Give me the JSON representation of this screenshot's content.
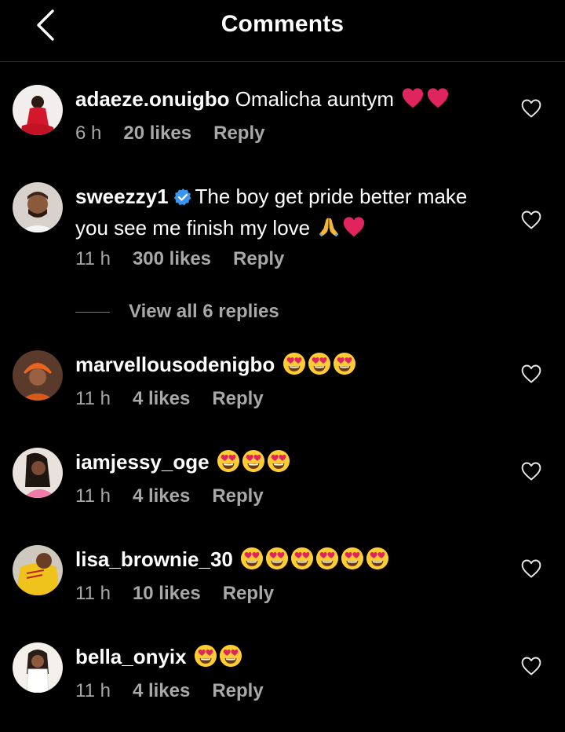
{
  "header": {
    "title": "Comments",
    "back_icon": "back-arrow-icon"
  },
  "comments": [
    {
      "username": "adaeze.onuigbo",
      "text": "Omalicha auntym",
      "emojis": [
        "heart",
        "heart"
      ],
      "time": "6 h",
      "likes": "20 likes",
      "reply": "Reply",
      "verified": false
    },
    {
      "username": "sweezzy1",
      "text_line1": "The boy get pride better make",
      "text_line2": "you see me finish my love",
      "emojis": [
        "pray",
        "heart"
      ],
      "time": "11 h",
      "likes": "300 likes",
      "reply": "Reply",
      "verified": true
    },
    {
      "username": "marvellousodenigbo",
      "text": "",
      "emojis": [
        "heart-eyes",
        "heart-eyes",
        "heart-eyes"
      ],
      "time": "11 h",
      "likes": "4 likes",
      "reply": "Reply",
      "verified": false
    },
    {
      "username": "iamjessy_oge",
      "text": "",
      "emojis": [
        "heart-eyes",
        "heart-eyes",
        "heart-eyes"
      ],
      "time": "11 h",
      "likes": "4 likes",
      "reply": "Reply",
      "verified": false
    },
    {
      "username": "lisa_brownie_30",
      "text": "",
      "emojis": [
        "heart-eyes",
        "heart-eyes",
        "heart-eyes",
        "heart-eyes",
        "heart-eyes",
        "heart-eyes"
      ],
      "time": "11 h",
      "likes": "10 likes",
      "reply": "Reply",
      "verified": false
    },
    {
      "username": "bella_onyix",
      "text": "",
      "emojis": [
        "heart-eyes",
        "heart-eyes"
      ],
      "time": "11 h",
      "likes": "4 likes",
      "reply": "Reply",
      "verified": false
    }
  ],
  "view_replies": {
    "label": "View all 6 replies"
  },
  "colors": {
    "background": "#000000",
    "meta_text": "#a8a8a8",
    "verified": "#3897f0",
    "heart_emoji": "#e0245e",
    "emoji_face": "#ffcc33"
  }
}
